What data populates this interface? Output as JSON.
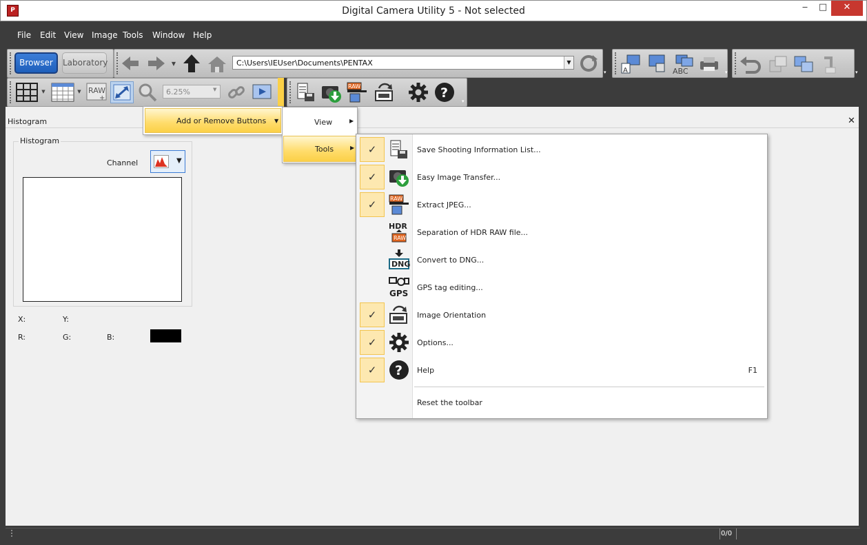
{
  "window": {
    "title": "Digital Camera Utility 5 - Not selected",
    "app_icon": "pentax-app-icon",
    "controls": {
      "minimize": "‒",
      "maximize": "□",
      "close": "✕"
    }
  },
  "menubar": [
    "File",
    "Edit",
    "View",
    "Image",
    "Tools",
    "Window",
    "Help"
  ],
  "toolbar": {
    "browser_label": "Browser",
    "laboratory_label": "Laboratory",
    "path_value": "C:\\Users\\IEUser\\Documents\\PENTAX",
    "zoom_value": "6.25%"
  },
  "histogram_panel": {
    "header": "Histogram",
    "group_label": "Histogram",
    "channel_label": "Channel",
    "x_label": "X:",
    "y_label": "Y:",
    "r_label": "R:",
    "g_label": "G:",
    "b_label": "B:",
    "swatch_color": "#000000"
  },
  "status": {
    "count": "0/0"
  },
  "context_menu": {
    "item": "Add or Remove Buttons",
    "submenu": [
      "View",
      "Tools"
    ],
    "tools_items": [
      {
        "label": "Save Shooting Information List...",
        "checked": true,
        "icon": "save-list-icon",
        "key": ""
      },
      {
        "label": "Easy Image Transfer...",
        "checked": true,
        "icon": "camera-download-icon",
        "key": ""
      },
      {
        "label": "Extract JPEG...",
        "checked": true,
        "icon": "raw-extract-icon",
        "key": ""
      },
      {
        "label": "Separation of HDR RAW file...",
        "checked": false,
        "icon": "hdr-raw-icon",
        "key": ""
      },
      {
        "label": "Convert to DNG...",
        "checked": false,
        "icon": "dng-icon",
        "key": ""
      },
      {
        "label": "GPS tag editing...",
        "checked": false,
        "icon": "gps-icon",
        "key": ""
      },
      {
        "label": "Image Orientation",
        "checked": true,
        "icon": "orientation-icon",
        "key": ""
      },
      {
        "label": "Options...",
        "checked": true,
        "icon": "gear-icon",
        "key": ""
      },
      {
        "label": "Help",
        "checked": true,
        "icon": "help-icon",
        "key": "F1"
      }
    ],
    "reset_label": "Reset the toolbar"
  }
}
